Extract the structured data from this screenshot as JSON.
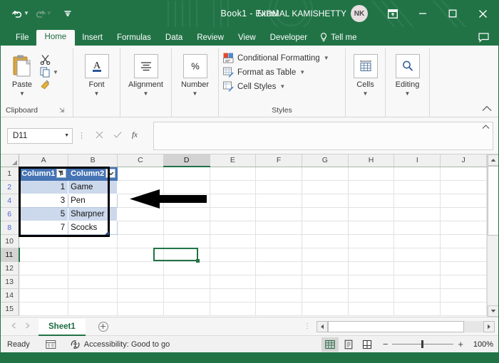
{
  "titlebar": {
    "undo_icon": "undo-icon",
    "redo_icon": "redo-icon",
    "customize_icon": "customize-qat-icon",
    "title": "Book1  -  Excel",
    "user_name": "NIRMAL KAMISHETTY",
    "avatar_initials": "NK",
    "ribbon_display_icon": "ribbon-display-options-icon",
    "minimize_icon": "minimize-icon",
    "maximize_icon": "maximize-icon",
    "close_icon": "close-icon"
  },
  "tabs": {
    "items": [
      {
        "label": "File",
        "active": false
      },
      {
        "label": "Home",
        "active": true
      },
      {
        "label": "Insert",
        "active": false
      },
      {
        "label": "Formulas",
        "active": false
      },
      {
        "label": "Data",
        "active": false
      },
      {
        "label": "Review",
        "active": false
      },
      {
        "label": "View",
        "active": false
      },
      {
        "label": "Developer",
        "active": false
      }
    ],
    "tell_me": "Tell me",
    "tell_me_icon": "lightbulb-icon",
    "comment_icon": "comment-icon"
  },
  "ribbon": {
    "clipboard": {
      "group_label": "Clipboard",
      "paste_label": "Paste",
      "paste_icon": "paste-icon",
      "cut_icon": "scissors-icon",
      "copy_icon": "copy-icon",
      "format_painter_icon": "format-painter-icon",
      "launcher_icon": "dialog-launcher-icon"
    },
    "font": {
      "label": "Font",
      "icon": "font-a-icon"
    },
    "alignment": {
      "label": "Alignment",
      "icon": "align-center-icon"
    },
    "number": {
      "label": "Number",
      "icon": "percent-icon"
    },
    "styles": {
      "group_label": "Styles",
      "items": [
        {
          "label": "Conditional Formatting",
          "icon": "conditional-formatting-icon"
        },
        {
          "label": "Format as Table",
          "icon": "format-as-table-icon"
        },
        {
          "label": "Cell Styles",
          "icon": "cell-styles-icon"
        }
      ]
    },
    "cells": {
      "label": "Cells",
      "icon": "cells-icon"
    },
    "editing": {
      "label": "Editing",
      "icon": "find-magnifier-icon"
    },
    "collapse_icon": "collapse-ribbon-icon"
  },
  "formula_bar": {
    "name_box_value": "D11",
    "name_box_caret": "name-box-dropdown-icon",
    "cancel_icon": "cancel-icon",
    "enter_icon": "enter-check-icon",
    "function_icon": "insert-function-fx-icon",
    "formula_value": "",
    "expand_icon": "expand-formula-bar-icon"
  },
  "grid": {
    "column_headers": [
      "A",
      "B",
      "C",
      "D",
      "E",
      "F",
      "G",
      "H",
      "I",
      "J"
    ],
    "selected_column": "D",
    "row_headers": [
      "1",
      "2",
      "4",
      "6",
      "8",
      "10",
      "11",
      "12",
      "13",
      "14",
      "15"
    ],
    "filtered_rows": [
      "2",
      "4",
      "6",
      "8"
    ],
    "selected_row": "11",
    "active_cell": "D11",
    "table": {
      "headers": [
        "Column1",
        "Column2"
      ],
      "header_filter_icons": [
        "filter-applied-icon",
        "filter-dropdown-icon"
      ],
      "rows": [
        {
          "col1": "1",
          "col2": "Game",
          "banded": true
        },
        {
          "col1": "3",
          "col2": "Pen",
          "banded": false
        },
        {
          "col1": "5",
          "col2": "Sharpner",
          "banded": true
        },
        {
          "col1": "7",
          "col2": "Scocks",
          "banded": false
        }
      ],
      "header_color": "#4674b4",
      "band_color": "#ccd9ec",
      "outline_color": "#000000"
    },
    "annotation": {
      "icon": "left-pointing-arrow-annotation",
      "color": "#000000"
    },
    "vscroll_up_icon": "scroll-up-icon",
    "vscroll_down_icon": "scroll-down-icon"
  },
  "sheet_tabs": {
    "prev_icon": "previous-sheet-icon",
    "next_icon": "next-sheet-icon",
    "sheets": [
      {
        "name": "Sheet1",
        "active": true
      }
    ],
    "add_sheet_icon": "add-sheet-icon",
    "hscroll_left_icon": "scroll-left-icon",
    "hscroll_right_icon": "scroll-right-icon"
  },
  "status_bar": {
    "mode": "Ready",
    "macro_icon": "record-macro-icon",
    "accessibility_icon": "accessibility-icon",
    "accessibility_text": "Accessibility: Good to go",
    "views": [
      {
        "name": "normal-view-icon",
        "active": true
      },
      {
        "name": "page-layout-view-icon",
        "active": false
      },
      {
        "name": "page-break-preview-icon",
        "active": false
      }
    ],
    "zoom_out": "−",
    "zoom_in": "+",
    "zoom_level": "100%"
  },
  "colors": {
    "excel_green": "#217346",
    "table_blue": "#4674b4",
    "band_blue": "#ccd9ec",
    "accent_selection": "#217346"
  }
}
